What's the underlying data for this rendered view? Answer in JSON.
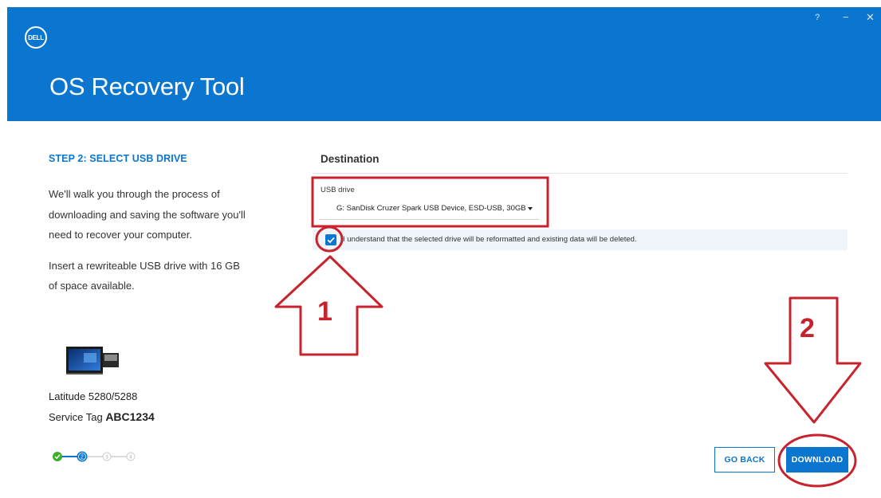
{
  "window": {
    "help_icon": "?",
    "minimize_icon": "−",
    "close_icon": "✕"
  },
  "header": {
    "logo_text": "DELL",
    "app_title": "OS Recovery Tool",
    "background_color": "#0a76cf"
  },
  "left_panel": {
    "step_title": "STEP 2: SELECT USB DRIVE",
    "description_1": "We'll walk you through the process of downloading and saving the software you'll need to recover your computer.",
    "description_2": "Insert a rewriteable USB drive with 16 GB of space available.",
    "device_model": "Latitude 5280/5288",
    "service_tag_label": "Service Tag",
    "service_tag_value": "ABC1234",
    "progress_steps": [
      {
        "label": "",
        "state": "complete"
      },
      {
        "label": "2",
        "state": "current"
      },
      {
        "label": "3",
        "state": "upcoming"
      },
      {
        "label": "4",
        "state": "upcoming"
      }
    ]
  },
  "destination": {
    "section_title": "Destination",
    "usb_label": "USB drive",
    "usb_selected": "G: SanDisk Cruzer Spark USB Device, ESD-USB, 30GB",
    "acknowledge_checked": true,
    "acknowledge_text": "I understand that the selected drive will be reformatted and existing data will be deleted."
  },
  "buttons": {
    "go_back": "GO BACK",
    "download": "DOWNLOAD"
  },
  "annotations": {
    "arrow_1_label": "1",
    "arrow_2_label": "2",
    "highlight_color": "#c8232c"
  }
}
